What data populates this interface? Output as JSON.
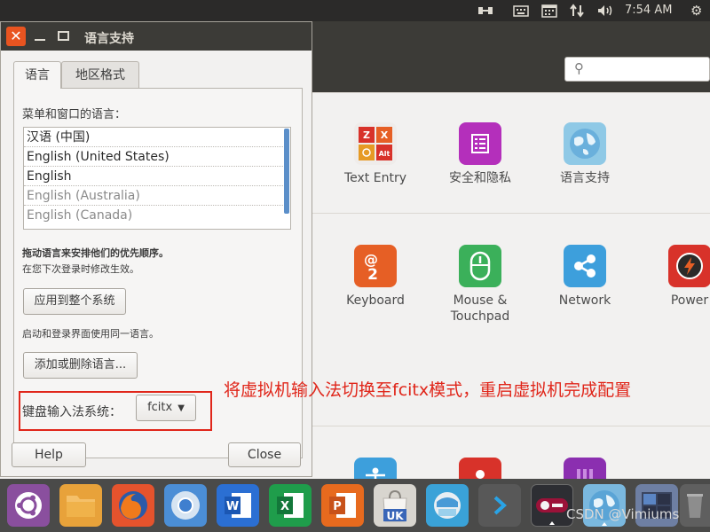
{
  "top_panel": {
    "time": "7:54 AM",
    "icons": [
      "network-icon",
      "keyboard-icon",
      "calendar-icon",
      "transfer-icon",
      "volume-icon",
      "power-gear-icon"
    ]
  },
  "system_settings": {
    "search": {
      "placeholder": ""
    },
    "items": [
      {
        "label": "Text Entry",
        "icon": "text-entry-icon",
        "color": "#c9c4bd"
      },
      {
        "label": "安全和隐私",
        "icon": "security-privacy-icon",
        "color": "#b42fbb"
      },
      {
        "label": "语言支持",
        "icon": "language-support-icon",
        "color": "#8fc9e6"
      },
      {
        "label": "Keyboard",
        "icon": "keyboard-settings-icon",
        "color": "#e65f25"
      },
      {
        "label": "Mouse & Touchpad",
        "icon": "mouse-touchpad-icon",
        "color": "#3bb05a"
      },
      {
        "label": "Network",
        "icon": "network-settings-icon",
        "color": "#3d9fdc"
      },
      {
        "label": "Power",
        "icon": "power-settings-icon",
        "color": "#d8322a"
      }
    ]
  },
  "dialog": {
    "title": "语言支持",
    "tabs": [
      {
        "label": "语言",
        "active": true
      },
      {
        "label": "地区格式",
        "active": false
      }
    ],
    "menu_language_label": "菜单和窗口的语言：",
    "languages": [
      {
        "label": "汉语 (中国)",
        "enabled": true
      },
      {
        "label": "English (United States)",
        "enabled": true
      },
      {
        "label": "English",
        "enabled": true
      },
      {
        "label": "English (Australia)",
        "enabled": false
      },
      {
        "label": "English (Canada)",
        "enabled": false
      }
    ],
    "drag_hint": "拖动语言来安排他们的优先顺序。",
    "next_login_hint": "在您下次登录时修改生效。",
    "apply_button": "应用到整个系统",
    "login_screen_hint": "启动和登录界面使用同一语言。",
    "add_remove_button": "添加或删除语言...",
    "keyboard_input_label": "键盘输入法系统：",
    "keyboard_input_value": "fcitx",
    "help_button": "Help",
    "close_button": "Close"
  },
  "annotation": "将虚拟机输入法切换至fcitx模式，重启虚拟机完成配置",
  "watermark": "CSDN @Vimiums",
  "colors": {
    "ubuntu_orange": "#e95420",
    "annotation_red": "#e0261a",
    "panel_dark": "#3c3b37"
  },
  "dock": [
    {
      "name": "ubuntu-dash-icon",
      "color": "#8a4f9e"
    },
    {
      "name": "files-icon",
      "color": "#e8a23a"
    },
    {
      "name": "firefox-icon",
      "color": "#e5532d"
    },
    {
      "name": "chromium-icon",
      "color": "#4b8ed6"
    },
    {
      "name": "wps-writer-icon",
      "color": "#2b6fd3"
    },
    {
      "name": "wps-spreadsheet-icon",
      "color": "#1f9d4b"
    },
    {
      "name": "wps-presentation-icon",
      "color": "#e76a1e"
    },
    {
      "name": "software-center-icon",
      "color": "#d8d5cf"
    },
    {
      "name": "software-updater-icon",
      "color": "#3aa2d8"
    },
    {
      "name": "vscode-icon",
      "color": "#585858"
    },
    {
      "name": "language-switcher-icon",
      "color": "#2d2e33"
    },
    {
      "name": "language-support-dock-icon",
      "color": "#7ab8df"
    },
    {
      "name": "workspace-switcher-icon",
      "color": "#6e7fa3"
    },
    {
      "name": "trash-icon",
      "color": "#5f5f5f"
    }
  ]
}
